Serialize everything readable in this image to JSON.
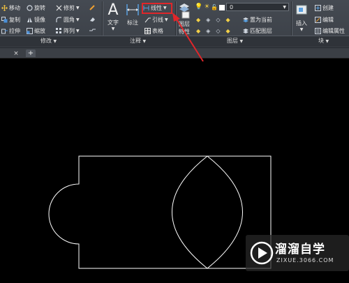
{
  "ribbon": {
    "modify": {
      "title": "修改",
      "move": "移动",
      "rotate": "旋转",
      "trim": "修剪",
      "copy": "复制",
      "mirror": "镜像",
      "fillet": "圆角",
      "stretch": "拉伸",
      "scale": "缩放",
      "array": "阵列"
    },
    "annotation": {
      "title": "注释",
      "text": "文字",
      "dimension": "标注",
      "linear": "线性",
      "leader": "引线",
      "table": "表格"
    },
    "layers": {
      "title": "图层",
      "properties_line1": "图层",
      "properties_line2": "特性",
      "current_layer": "0",
      "set_current": "置为当前",
      "match_layer": "匹配图层"
    },
    "block": {
      "title": "块",
      "insert": "插入",
      "create": "创建",
      "edit": "编辑",
      "edit_attributes": "编辑属性"
    }
  },
  "tabs": {
    "close": "×",
    "new": "+"
  },
  "watermark": {
    "title": "溜溜自学",
    "url": "ZIXUE.3066.COM"
  },
  "colors": {
    "highlight": "#e0262a",
    "arrow": "#e0262a",
    "geometry": "#ffffff",
    "canvas": "#000000"
  }
}
